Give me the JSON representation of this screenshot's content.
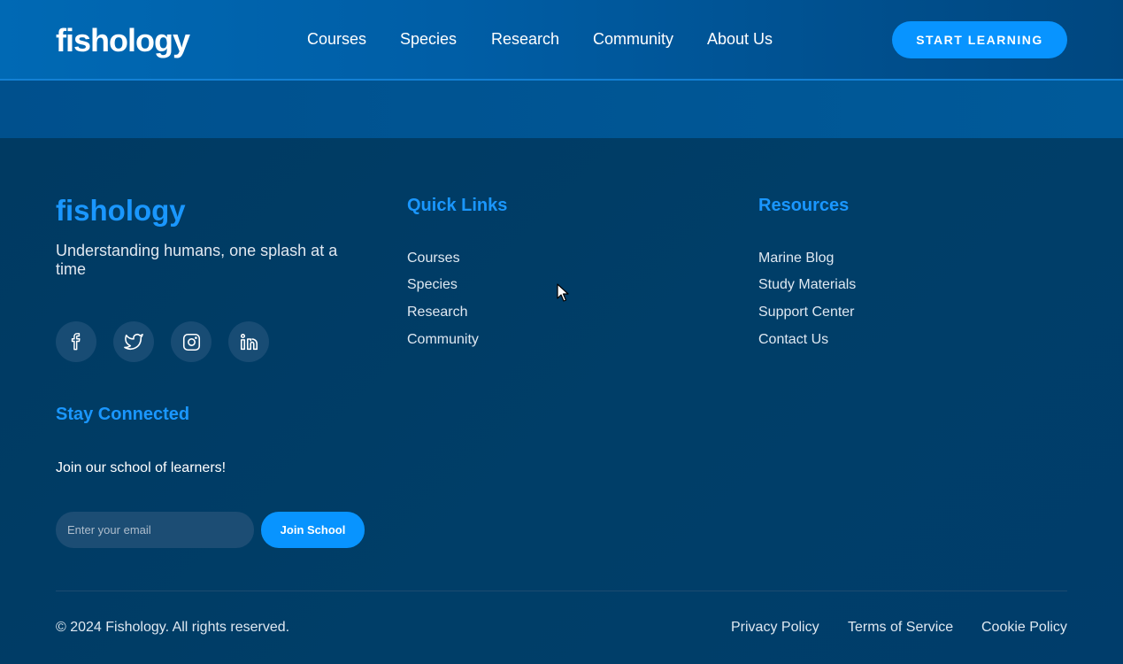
{
  "header": {
    "logo": "fishology",
    "nav": [
      "Courses",
      "Species",
      "Research",
      "Community",
      "About Us"
    ],
    "cta_label": "START LEARNING"
  },
  "footer": {
    "logo": "fishology",
    "tagline": "Understanding humans, one splash at a time",
    "social": [
      "facebook-icon",
      "twitter-icon",
      "instagram-icon",
      "linkedin-icon"
    ],
    "quick_links": {
      "title": "Quick Links",
      "items": [
        "Courses",
        "Species",
        "Research",
        "Community"
      ]
    },
    "resources": {
      "title": "Resources",
      "items": [
        "Marine Blog",
        "Study Materials",
        "Support Center",
        "Contact Us"
      ]
    },
    "stay_connected": {
      "title": "Stay Connected",
      "text": "Join our school of learners!",
      "email_placeholder": "Enter your email",
      "button_label": "Join School"
    },
    "copyright": "© 2024 Fishology. All rights reserved.",
    "legal": [
      "Privacy Policy",
      "Terms of Service",
      "Cookie Policy"
    ]
  },
  "colors": {
    "accent": "#0894ff",
    "heading": "#1a97ff",
    "footer_bg": "#003a63"
  }
}
